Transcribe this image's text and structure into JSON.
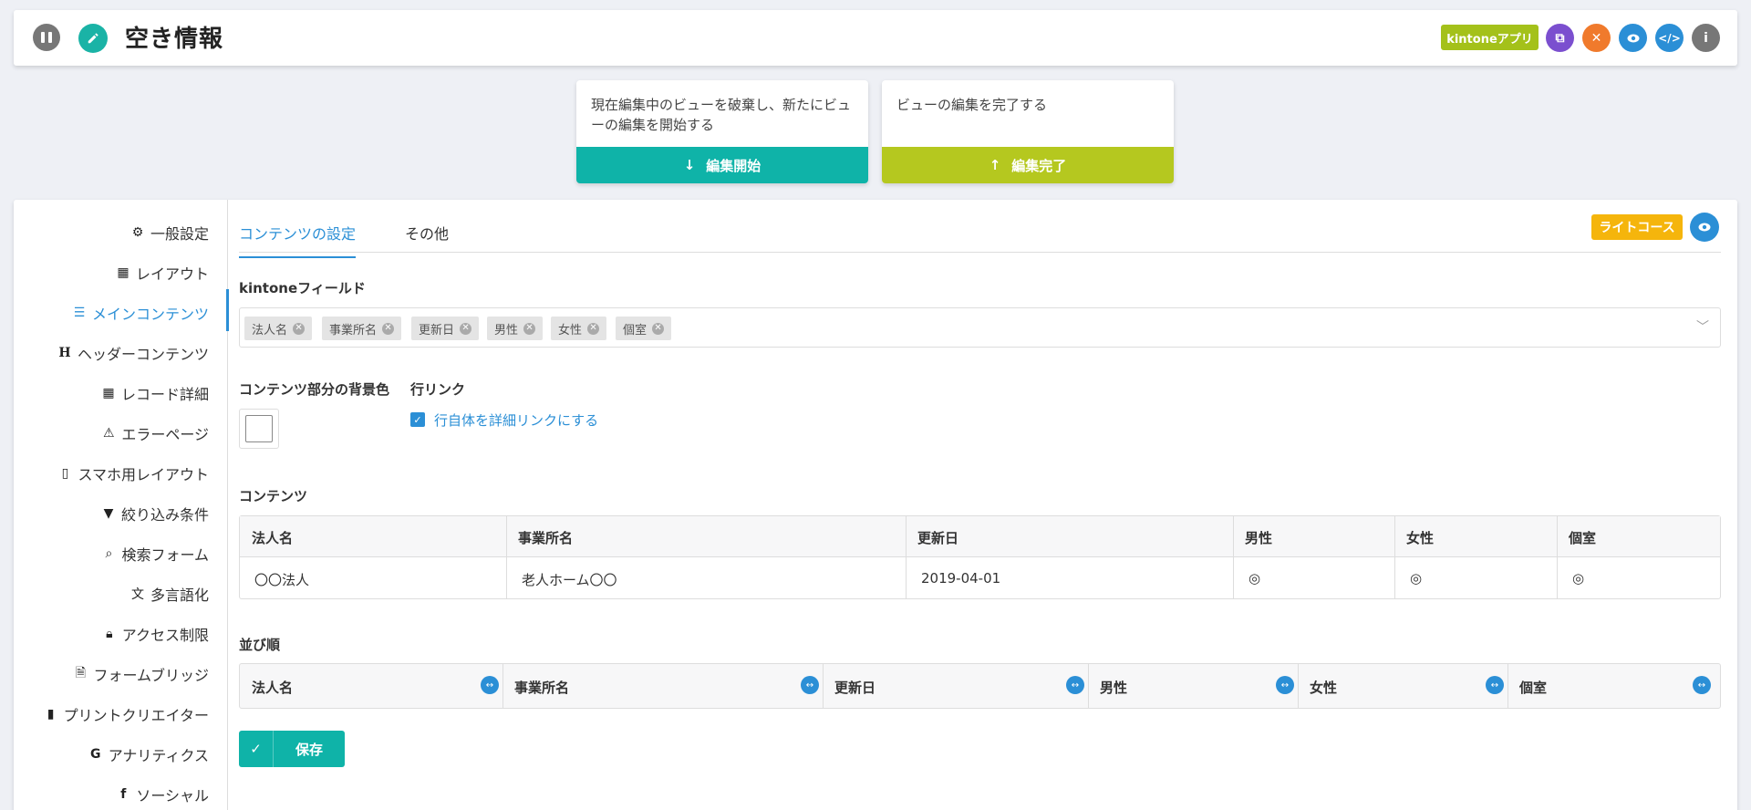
{
  "header": {
    "title": "空き情報",
    "kintone_badge": "kintoneアプリ"
  },
  "edit_cards": {
    "start": {
      "text": "現在編集中のビューを破棄し、新たにビューの編集を開始する",
      "button": "編集開始"
    },
    "done": {
      "text": "ビューの編集を完了する",
      "button": "編集完了"
    }
  },
  "sidebar": {
    "items": [
      {
        "label": "一般設定",
        "icon": "gears-icon"
      },
      {
        "label": "レイアウト",
        "icon": "grid-icon"
      },
      {
        "label": "メインコンテンツ",
        "icon": "list-icon"
      },
      {
        "label": "ヘッダーコンテンツ",
        "icon": "heading-icon"
      },
      {
        "label": "レコード詳細",
        "icon": "table-grid-icon"
      },
      {
        "label": "エラーページ",
        "icon": "warning-icon"
      },
      {
        "label": "スマホ用レイアウト",
        "icon": "mobile-icon"
      },
      {
        "label": "絞り込み条件",
        "icon": "filter-icon"
      },
      {
        "label": "検索フォーム",
        "icon": "search-icon"
      },
      {
        "label": "多言語化",
        "icon": "language-icon"
      },
      {
        "label": "アクセス制限",
        "icon": "lock-icon"
      },
      {
        "label": "フォームブリッジ",
        "icon": "file-icon"
      },
      {
        "label": "プリントクリエイター",
        "icon": "file-solid-icon"
      },
      {
        "label": "アナリティクス",
        "icon": "google-icon"
      },
      {
        "label": "ソーシャル",
        "icon": "facebook-icon"
      }
    ],
    "active_index": 2
  },
  "tabs": [
    "コンテンツの設定",
    "その他"
  ],
  "plan_badge": "ライトコース",
  "fields": {
    "label": "kintoneフィールド",
    "chips": [
      "法人名",
      "事業所名",
      "更新日",
      "男性",
      "女性",
      "個室"
    ]
  },
  "bg_color": {
    "label": "コンテンツ部分の背景色",
    "value": "#ffffff"
  },
  "row_link": {
    "label": "行リンク",
    "checkbox_label": "行自体を詳細リンクにする",
    "checked": true
  },
  "contents": {
    "label": "コンテンツ",
    "columns": [
      "法人名",
      "事業所名",
      "更新日",
      "男性",
      "女性",
      "個室"
    ],
    "row": [
      "〇〇法人",
      "老人ホーム〇〇",
      "2019-04-01",
      "◎",
      "◎",
      "◎"
    ]
  },
  "sort": {
    "label": "並び順",
    "columns": [
      "法人名",
      "事業所名",
      "更新日",
      "男性",
      "女性",
      "個室"
    ]
  },
  "save_label": "保存",
  "colors": {
    "teal": "#0fb3a8",
    "lime": "#b5c81f",
    "blue": "#2b8fd6",
    "orange": "#f5b50c"
  }
}
